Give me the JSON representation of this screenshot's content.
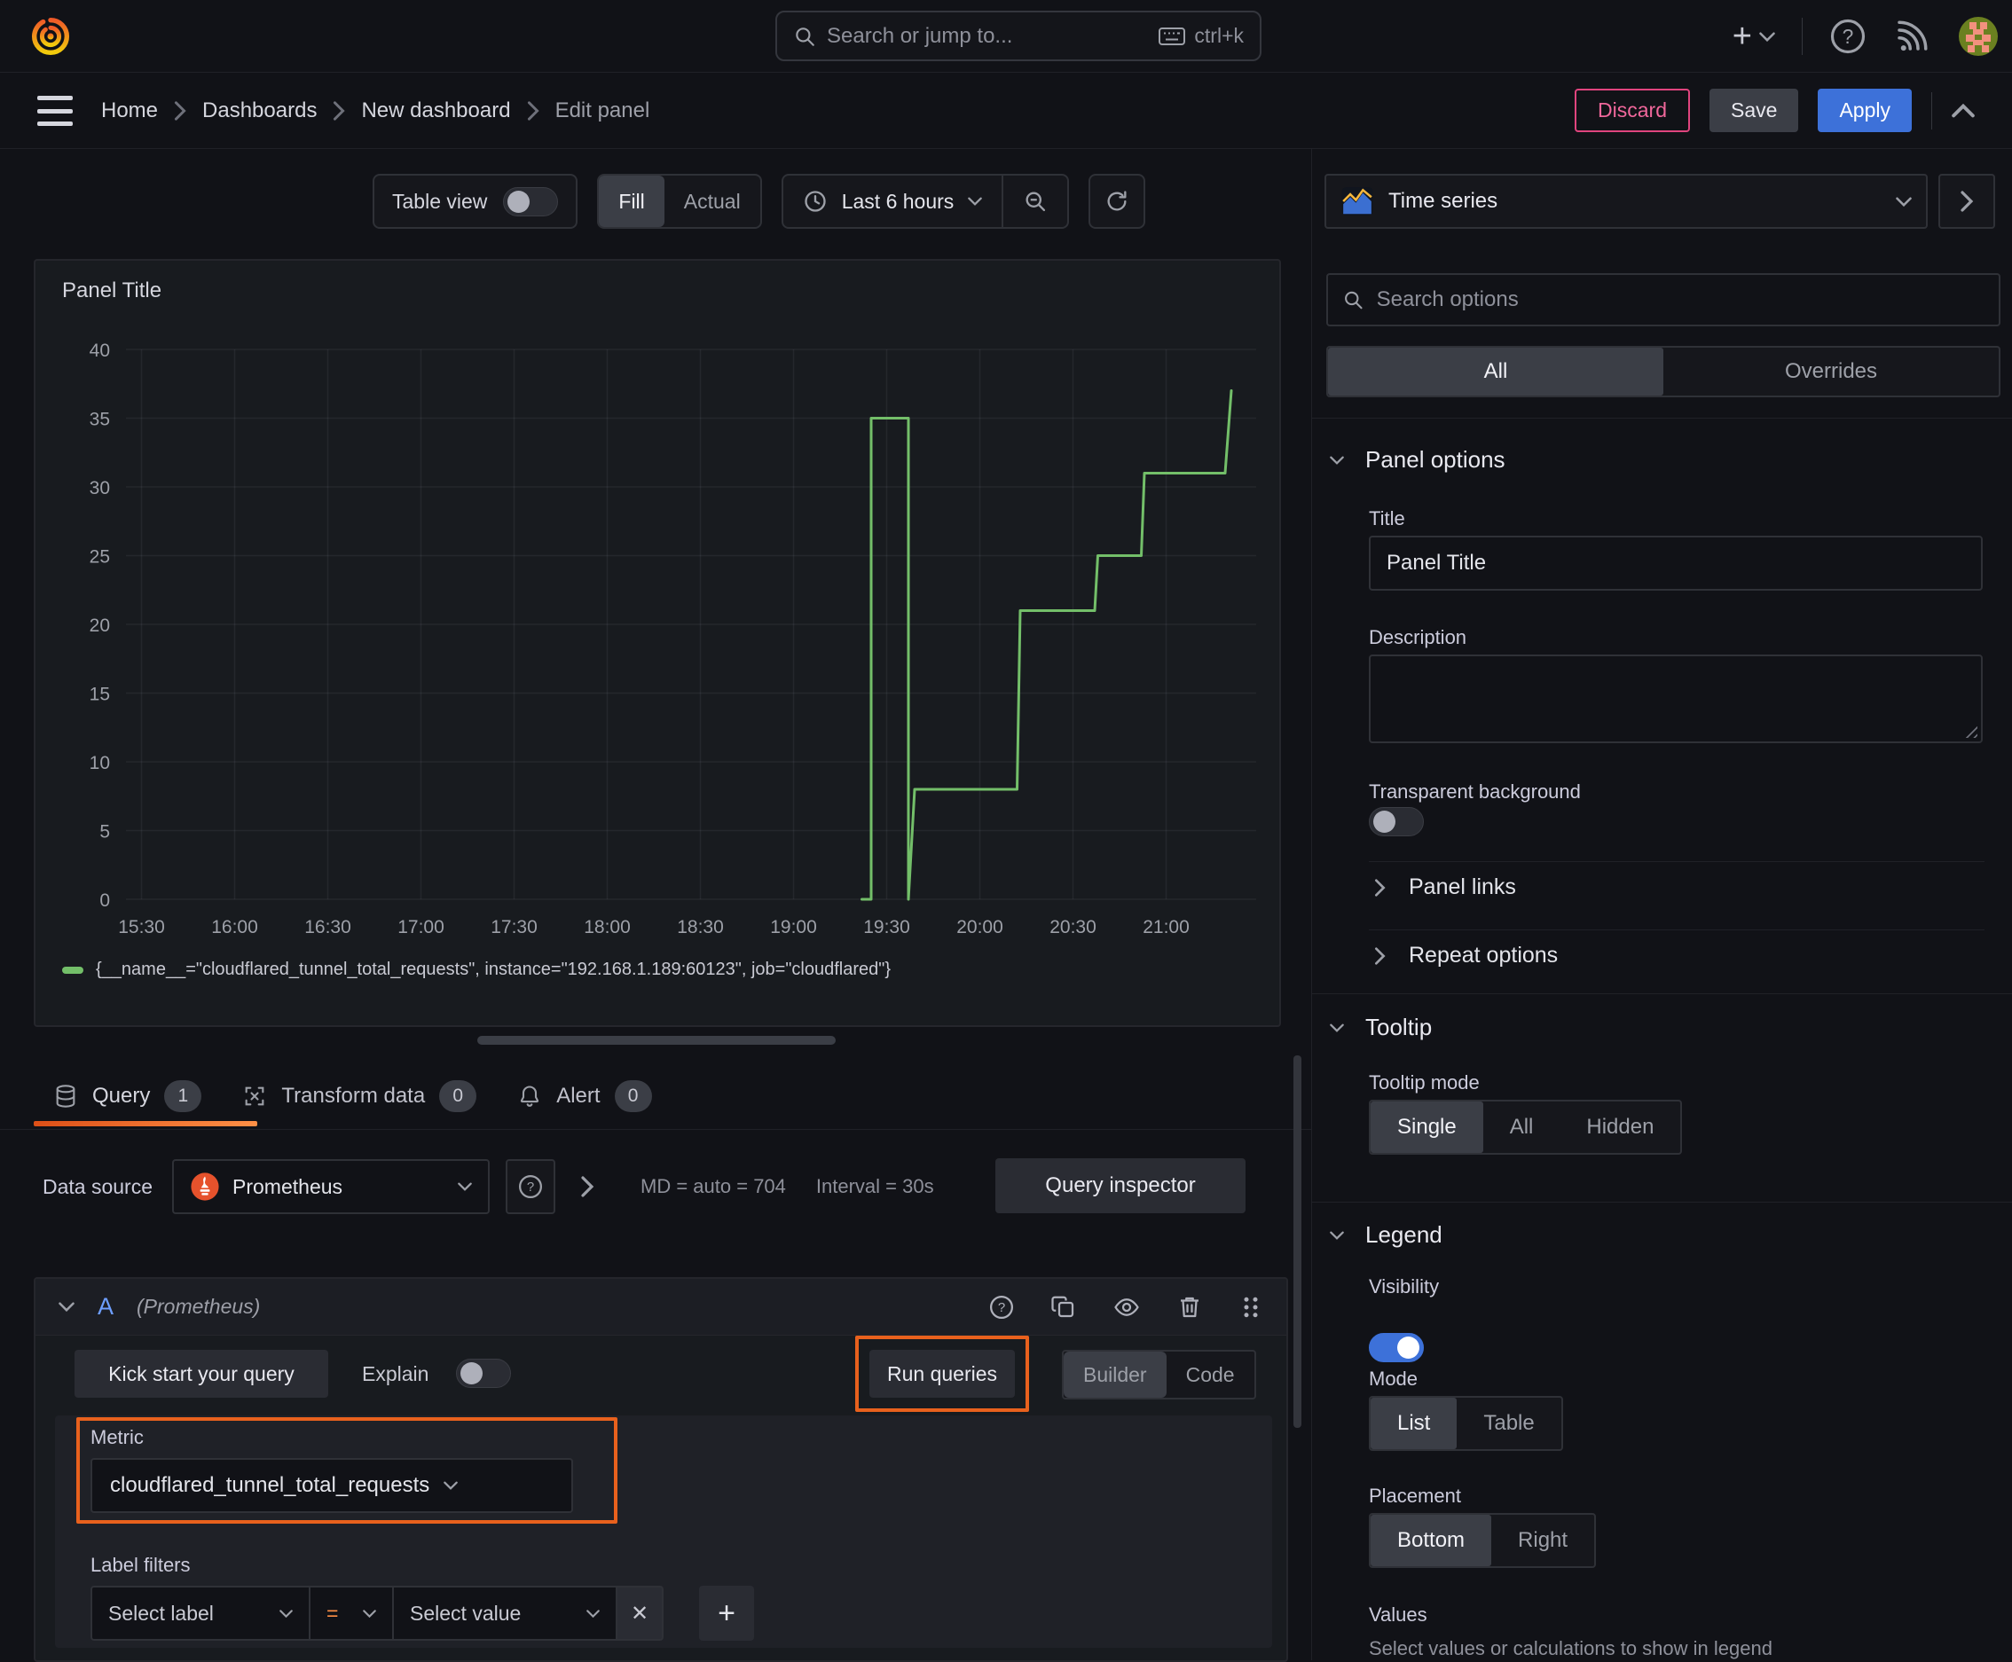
{
  "topbar": {
    "search_placeholder": "Search or jump to...",
    "shortcut": "ctrl+k",
    "plus": "+"
  },
  "breadcrumb": {
    "items": [
      "Home",
      "Dashboards",
      "New dashboard",
      "Edit panel"
    ]
  },
  "actions": {
    "discard": "Discard",
    "save": "Save",
    "apply": "Apply"
  },
  "toolbar": {
    "table_view": "Table view",
    "fill": "Fill",
    "actual": "Actual",
    "time_range": "Last 6 hours"
  },
  "viz_picker": {
    "label": "Time series"
  },
  "panel": {
    "title": "Panel Title"
  },
  "chart_data": {
    "type": "line",
    "title": "Panel Title",
    "x_min": "15:25",
    "x_max": "21:29",
    "x_ticks": [
      "15:30",
      "16:00",
      "16:30",
      "17:00",
      "17:30",
      "18:00",
      "18:30",
      "19:00",
      "19:30",
      "20:00",
      "20:30",
      "21:00"
    ],
    "y_ticks": [
      0,
      5,
      10,
      15,
      20,
      25,
      30,
      35,
      40
    ],
    "ylim": [
      0,
      40
    ],
    "grid": true,
    "legend_position": "bottom",
    "series": [
      {
        "name": "{__name__=\"cloudflared_tunnel_total_requests\", instance=\"192.168.1.189:60123\", job=\"cloudflared\"}",
        "color": "#73BF69",
        "points": [
          [
            "19:22",
            0
          ],
          [
            "19:25",
            0
          ],
          [
            "19:25",
            35
          ],
          [
            "19:37",
            35
          ],
          [
            "19:37",
            0
          ],
          [
            "19:39",
            8
          ],
          [
            "20:12",
            8
          ],
          [
            "20:13",
            21
          ],
          [
            "20:37",
            21
          ],
          [
            "20:38",
            25
          ],
          [
            "20:52",
            25
          ],
          [
            "20:53",
            31
          ],
          [
            "21:19",
            31
          ],
          [
            "21:21",
            37
          ]
        ]
      }
    ]
  },
  "tabs": {
    "query": {
      "label": "Query",
      "count": "1"
    },
    "transform": {
      "label": "Transform data",
      "count": "0"
    },
    "alert": {
      "label": "Alert",
      "count": "0"
    }
  },
  "datasource": {
    "label": "Data source",
    "name": "Prometheus",
    "stats_md": "MD = auto = 704",
    "stats_interval": "Interval = 30s",
    "query_inspector": "Query inspector"
  },
  "query_row": {
    "ref": "A",
    "ds": "(Prometheus)"
  },
  "query_toolbar": {
    "kick_start": "Kick start your query",
    "explain": "Explain",
    "run": "Run queries",
    "builder": "Builder",
    "code": "Code"
  },
  "metric": {
    "label": "Metric",
    "value": "cloudflared_tunnel_total_requests"
  },
  "label_filters": {
    "label": "Label filters",
    "select_label": "Select label",
    "operator": "=",
    "select_value": "Select value",
    "close": "✕",
    "add": "+"
  },
  "options": {
    "search_placeholder": "Search options",
    "tabs": {
      "all": "All",
      "overrides": "Overrides"
    },
    "panel_options": {
      "title": "Panel options",
      "title_label": "Title",
      "title_value": "Panel Title",
      "description_label": "Description",
      "transparent_label": "Transparent background"
    },
    "panel_links": "Panel links",
    "repeat_options": "Repeat options",
    "tooltip": {
      "title": "Tooltip",
      "mode_label": "Tooltip mode",
      "modes": [
        "Single",
        "All",
        "Hidden"
      ]
    },
    "legend": {
      "title": "Legend",
      "visibility_label": "Visibility",
      "mode_label": "Mode",
      "modes": [
        "List",
        "Table"
      ],
      "placement_label": "Placement",
      "placements": [
        "Bottom",
        "Right"
      ],
      "values_label": "Values",
      "values_help": "Select values or calculations to show in legend"
    }
  }
}
